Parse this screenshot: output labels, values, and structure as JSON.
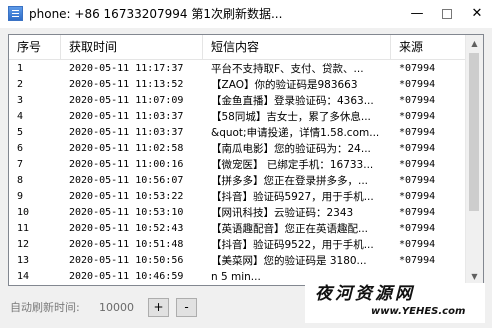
{
  "window": {
    "title": "phone: +86 16733207994  第1次刷新数据...",
    "min_glyph": "—",
    "close_glyph": "✕"
  },
  "table": {
    "headers": [
      "序号",
      "获取时间",
      "短信内容",
      "来源"
    ],
    "rows": [
      {
        "no": "1",
        "time": "2020-05-11 11:17:37",
        "content": "平台不支持取F、支付、贷款、...",
        "source": "*07994"
      },
      {
        "no": "2",
        "time": "2020-05-11 11:13:52",
        "content": "【ZAO】你的验证码是983663",
        "source": "*07994"
      },
      {
        "no": "3",
        "time": "2020-05-11 11:07:09",
        "content": "【金鱼直播】登录验证码：4363...",
        "source": "*07994"
      },
      {
        "no": "4",
        "time": "2020-05-11 11:03:37",
        "content": "【58同城】吉女士，累了多休息...",
        "source": "*07994"
      },
      {
        "no": "5",
        "time": "2020-05-11 11:03:37",
        "content": "&quot;申请投递，详情1.58.com...",
        "source": "*07994"
      },
      {
        "no": "6",
        "time": "2020-05-11 11:02:58",
        "content": "【南瓜电影】您的验证码为：24...",
        "source": "*07994"
      },
      {
        "no": "7",
        "time": "2020-05-11 11:00:16",
        "content": "【微宠医】 已绑定手机：16733...",
        "source": "*07994"
      },
      {
        "no": "8",
        "time": "2020-05-11 10:56:07",
        "content": "【拼多多】您正在登录拼多多，...",
        "source": "*07994"
      },
      {
        "no": "9",
        "time": "2020-05-11 10:53:22",
        "content": "【抖音】验证码5927，用于手机...",
        "source": "*07994"
      },
      {
        "no": "10",
        "time": "2020-05-11 10:53:10",
        "content": "【网讯科技】云验证码：2343",
        "source": "*07994"
      },
      {
        "no": "11",
        "time": "2020-05-11 10:52:43",
        "content": "【英语趣配音】您正在英语趣配...",
        "source": "*07994"
      },
      {
        "no": "12",
        "time": "2020-05-11 10:51:48",
        "content": "【抖音】验证码9522，用于手机...",
        "source": "*07994"
      },
      {
        "no": "13",
        "time": "2020-05-11 10:50:56",
        "content": "【美菜网】您的验证码是 3180...",
        "source": "*07994"
      },
      {
        "no": "14",
        "time": "2020-05-11 10:46:59",
        "content": "n 5 min...",
        "source": ""
      }
    ]
  },
  "controls": {
    "refresh_label": "自动刷新时间:",
    "refresh_value": "10000",
    "plus_label": "+",
    "minus_label": "-"
  },
  "watermark": {
    "title": "夜河资源网",
    "url": "www.YEHES.com"
  }
}
